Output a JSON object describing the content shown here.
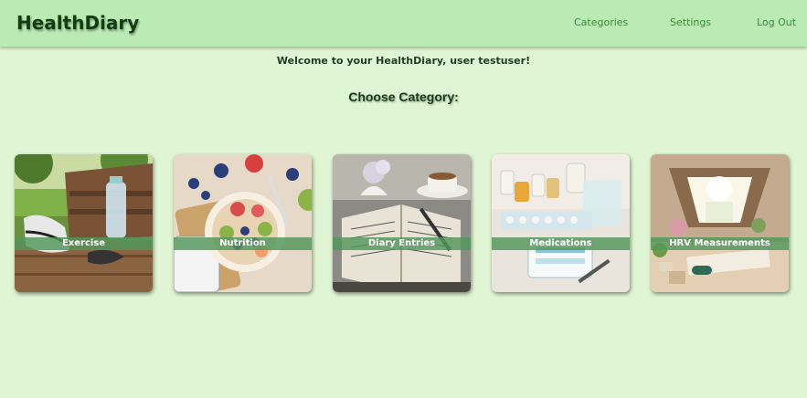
{
  "brand": "HealthDiary",
  "nav": {
    "categories": "Categories",
    "settings": "Settings",
    "logout": "Log Out"
  },
  "welcome": "Welcome to your HealthDiary, user testuser!",
  "heading": "Choose Category:",
  "categories": [
    {
      "label": "Exercise",
      "image": "sneakers-water-bottle-on-bench-photo"
    },
    {
      "label": "Nutrition",
      "image": "oatmeal-bowl-with-fruit-photo"
    },
    {
      "label": "Diary Entries",
      "image": "open-journal-and-coffee-photo"
    },
    {
      "label": "Medications",
      "image": "pill-organizer-and-water-glass-photo"
    },
    {
      "label": "HRV Measurements",
      "image": "meditation-room-illustration"
    }
  ],
  "colors": {
    "background": "#dff5d3",
    "topbar": "#b9ebb3",
    "brand_text": "#123d12",
    "nav_link": "#3f8a3f",
    "label_strip": "#52965a"
  }
}
